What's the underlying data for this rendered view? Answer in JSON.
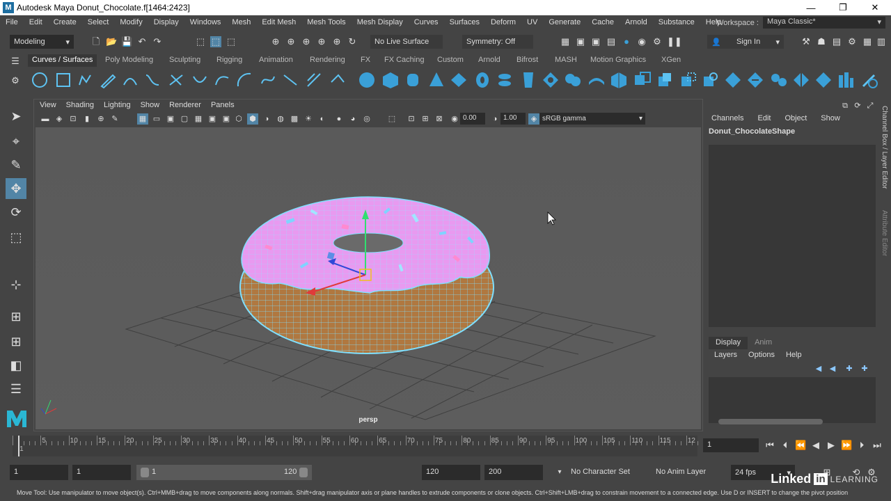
{
  "window": {
    "title": "Autodesk Maya  Donut_Chocolate.f[1464:2423]",
    "controls": [
      "—",
      "❐",
      "✕"
    ]
  },
  "menubar": {
    "items": [
      "File",
      "Edit",
      "Create",
      "Select",
      "Modify",
      "Display",
      "Windows",
      "Mesh",
      "Edit Mesh",
      "Mesh Tools",
      "Mesh Display",
      "Curves",
      "Surfaces",
      "Deform",
      "UV",
      "Generate",
      "Cache",
      "Arnold",
      "Substance",
      "Help"
    ],
    "workspace_label": "Workspace :",
    "workspace_value": "Maya Classic*"
  },
  "statusline": {
    "mode": "Modeling",
    "live_surface": "No Live Surface",
    "symmetry": "Symmetry: Off",
    "sign_in": "Sign In"
  },
  "shelf": {
    "tabs": [
      "Curves / Surfaces",
      "Poly Modeling",
      "Sculpting",
      "Rigging",
      "Animation",
      "Rendering",
      "FX",
      "FX Caching",
      "Custom",
      "Arnold",
      "Bifrost",
      "MASH",
      "Motion Graphics",
      "XGen"
    ],
    "active_tab": "Curves / Surfaces"
  },
  "viewport": {
    "menu": [
      "View",
      "Shading",
      "Lighting",
      "Show",
      "Renderer",
      "Panels"
    ],
    "exposure": "0.00",
    "gamma": "1.00",
    "color_space": "sRGB gamma",
    "camera": "persp"
  },
  "channelbox": {
    "menu": [
      "Channels",
      "Edit",
      "Object",
      "Show"
    ],
    "object_name": "Donut_ChocolateShape",
    "layer_tabs": [
      "Display",
      "Anim"
    ],
    "layer_menu": [
      "Layers",
      "Options",
      "Help"
    ],
    "side_tabs": [
      "Channel Box / Layer Editor",
      "Attribute Editor"
    ]
  },
  "timeslider": {
    "ticks": [
      "1",
      "5",
      "10",
      "15",
      "20",
      "25",
      "30",
      "35",
      "40",
      "45",
      "50",
      "55",
      "60",
      "65",
      "70",
      "75",
      "80",
      "85",
      "90",
      "95",
      "100",
      "105",
      "110",
      "115",
      "12"
    ],
    "current_frame": "1"
  },
  "rangebar": {
    "start": "1",
    "playback_start": "1",
    "range_start": "1",
    "range_end": "120",
    "playback_end": "120",
    "end": "200",
    "character_set": "No Character Set",
    "anim_layer": "No Anim Layer",
    "fps": "24 fps"
  },
  "help_line": "Move Tool: Use manipulator to move object(s). Ctrl+MMB+drag to move components along normals. Shift+drag manipulator axis or plane handles to extrude components or clone objects. Ctrl+Shift+LMB+drag to constrain movement to a connected edge. Use D or INSERT to change the pivot position",
  "branding": {
    "linkedin": "Linked",
    "in": "in",
    "learning": "LEARNING"
  },
  "colors": {
    "ui_bg": "#444444",
    "field_bg": "#2b2b2b",
    "viewport_bg": "#5b5b5b",
    "icing": "#e89af0",
    "wire": "#7fe0ff",
    "dough": "#b07840",
    "shelf_icon": "#3aa0d8"
  }
}
